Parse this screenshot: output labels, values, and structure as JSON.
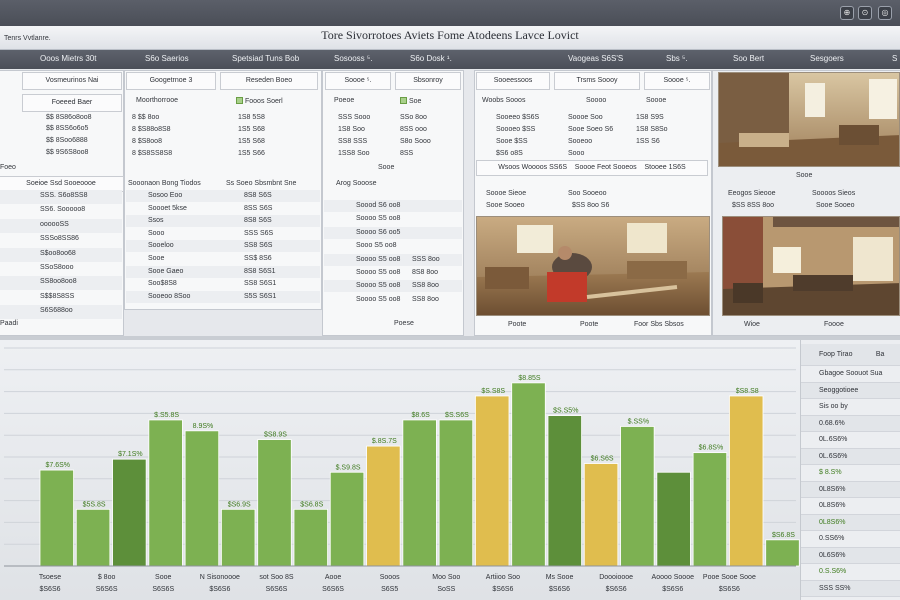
{
  "window": {
    "title": "Tore Sivorrotoes Aviets Fome Atodeens Lavce Lovict",
    "subtitle": "Tenrs Vvtlanre.",
    "buttons": [
      "⊕",
      "⊙",
      "◎"
    ]
  },
  "headers": [
    "Ooos Mietrs 30t",
    "S6o Saerios",
    "Spetsiad Tuns Bob",
    "Sosooss ⁵.",
    "S6o Dosk ¹.",
    "Vaogeas S6S'S",
    "Sbs ⁵.",
    "Soo Bert",
    "Sesgoers",
    "S"
  ],
  "table1": {
    "col_headers": [
      "Vosmeurinos Nai",
      "Foeeed Baer"
    ],
    "rows": [
      "$$ 8S86o8oo8",
      "$$ 8SS6o6o5",
      "$$ 8Soo6888",
      "$$ 9S6S8oo8"
    ],
    "left_items": [
      "Foeo",
      "Paadi"
    ],
    "section_header": "Soeioe Ssd Sooeoooe",
    "list": [
      "SSS. S6o8SS8",
      "SS6. Sooooo8",
      "oooooSS",
      "SSSo8SS86",
      "S$oo8oo68",
      "SSoS8ooo",
      "SS8oo8oo8",
      "S$$8S8SS",
      "S6S688oo"
    ]
  },
  "table2": {
    "col_headers": [
      "Googetrnoe 3",
      "Reseden Boeo"
    ],
    "sub_headers": [
      "Moorthorrooe",
      "Fooos Soerl"
    ],
    "rows": [
      [
        "8 $$ 8oo",
        "1S8 5S8"
      ],
      [
        "8 $S88o8S8",
        "1S5 S68"
      ],
      [
        "8 $S8oo8",
        "1S5 S68"
      ],
      [
        "8 $S8SS8S8",
        "1S5 S66"
      ]
    ],
    "section_header": "Sooonaon Bong Tiodos",
    "section_header2": "Ss Soeo Sbsmbnt Sne",
    "list_a": [
      "Sosoo Eoo",
      "Soooet 5kse",
      "Ssos",
      "Sooo",
      "Sooeloo",
      "Sooe",
      "Sooe Gaeo",
      "Soo$8S8",
      "Sooeoo 8Soo"
    ],
    "list_b": [
      "8S8 S6S",
      "8SS S6S",
      "8S8 S6S",
      "SSS S6S",
      "SS8 S6S",
      "SS$ 8S6",
      "8S8 S6S1",
      "SS8 S6S1",
      "S5S S6S1"
    ]
  },
  "table3": {
    "col_headers": [
      "Soooe ⁵.",
      "Sbsonroy"
    ],
    "sub_headers": [
      "Poeoe",
      "Soe"
    ],
    "rows": [
      [
        "SSS Sooo",
        "SSo 8oo"
      ],
      [
        "1S8 Soo",
        "8SS ooo"
      ],
      [
        "SS8 SSS",
        "S8o Sooo"
      ],
      [
        "1SS8 Soo",
        "8SS"
      ]
    ],
    "section_header": "Arog Sooose",
    "mid_item": "Sooe",
    "list": [
      [
        "Soood S6 oo8",
        ""
      ],
      [
        "Soooo S5 oo8",
        ""
      ],
      [
        "Soooo S6 oo5",
        ""
      ],
      [
        "Sooo S5 oo8",
        ""
      ],
      [
        "Soooo S5 oo8",
        "SSS 8oo"
      ],
      [
        "Soooo S5 oo8",
        "8S8 8oo"
      ],
      [
        "Soooo S5 oo8",
        "SS8 8oo"
      ],
      [
        "Soooo S5 oo8",
        "SS8 8oo"
      ]
    ],
    "footer": "Poese"
  },
  "table4": {
    "col_headers": [
      "Sooeessoos",
      "Trsms Soooy",
      "Soooe ⁵."
    ],
    "sub_headers": [
      "Woobs Sooos",
      "Soooo",
      "Soooe"
    ],
    "rows": [
      [
        "Sooeeo $S6S",
        "Soooe Soo",
        "1S8 S9S"
      ],
      [
        "Soooeo $SS",
        "Sooe Soeo S6",
        "1S8 S8So"
      ],
      [
        "Sooe $SS",
        "Sooeoo",
        "1SS S6"
      ],
      [
        "$S6 o8S",
        "Sooo",
        ""
      ]
    ],
    "bottom": [
      "Wsoos Woooos SS6S",
      "Soooe Feot Sooeos",
      "Stooee 1S6S"
    ]
  },
  "photo_captions": {
    "p1": [
      "Sooe",
      "Soooe Sieoe",
      "Soo Sooeoo"
    ],
    "p1b": [
      "Sooe Sooeo",
      "$SS 8oo S6"
    ],
    "p2": [
      "Wooo",
      "Poote",
      "Soooe"
    ],
    "p3": [
      "Pooe",
      "Foor Sbs Sbsos"
    ],
    "p4": [
      "Wioe",
      "Foooe"
    ],
    "p4b": [
      "Eeogos Sieooe",
      "Soooos Sieos",
      "$SS 8SS 8oo",
      "Sooe Sooeo"
    ]
  },
  "right_panel": {
    "header": [
      "Foop Tirao",
      "Ba"
    ],
    "items": [
      "Gbagoe Soouot Sua",
      "Seoggotioee",
      "Sis oo by",
      "0.68.6%",
      "0L.6S6%",
      "0L.6S6%",
      "$ 8.S%",
      "0L8S6%",
      "0L8S6%",
      "0L8S6%",
      "0.SS6%",
      "0L6S6%",
      "0.S.S6%",
      "SSS SS%"
    ]
  },
  "chart_data": {
    "type": "bar",
    "grid": true,
    "ylim": [
      0,
      100
    ],
    "bars": [
      {
        "value": 44,
        "color": "#7db152",
        "label": "$7.6S%"
      },
      {
        "value": 26,
        "color": "#7db152",
        "label": "$5S.8S"
      },
      {
        "value": 49,
        "color": "#5d8f3a",
        "label": "$7.1S%"
      },
      {
        "value": 67,
        "color": "#7db152",
        "label": "$.S5.8S"
      },
      {
        "value": 62,
        "color": "#7db152",
        "label": "8.9S%"
      },
      {
        "value": 26,
        "color": "#7db152",
        "label": "$S6.9S"
      },
      {
        "value": 58,
        "color": "#7db152",
        "label": "$S8.9S"
      },
      {
        "value": 26,
        "color": "#7db152",
        "label": "$S6.8S"
      },
      {
        "value": 43,
        "color": "#7db152",
        "label": "$.S9.8S"
      },
      {
        "value": 55,
        "color": "#e0bd4e",
        "label": "$.8S.7S"
      },
      {
        "value": 67,
        "color": "#7db152",
        "label": "$8.6S"
      },
      {
        "value": 67,
        "color": "#7db152",
        "label": "$S.S6S"
      },
      {
        "value": 78,
        "color": "#e0bd4e",
        "label": "$S.S8S"
      },
      {
        "value": 84,
        "color": "#7db152",
        "label": "$8.85S"
      },
      {
        "value": 69,
        "color": "#5d8f3a",
        "label": "$S.S5%"
      },
      {
        "value": 47,
        "color": "#e0bd4e",
        "label": "$6.S6S"
      },
      {
        "value": 64,
        "color": "#7db152",
        "label": "$.SS%"
      },
      {
        "value": 43,
        "color": "#5d8f3a",
        "label": ""
      },
      {
        "value": 52,
        "color": "#7db152",
        "label": "$6.8S%"
      },
      {
        "value": 78,
        "color": "#e0bd4e",
        "label": "$S8.S8"
      },
      {
        "value": 12,
        "color": "#7db152",
        "label": "$S6.8S"
      }
    ],
    "x_labels": [
      [
        "Tsoese",
        "$S6S6"
      ],
      [
        "$ 8oo",
        "S6S6S"
      ],
      [
        "Sooe",
        "S6S6S"
      ],
      [
        "N Sisonoooe",
        "$S6S6"
      ],
      [
        "sot Soo 8S",
        "S6S6S"
      ],
      [
        "Aooe",
        "S6S6S"
      ],
      [
        "Sooos",
        "S6S5"
      ],
      [
        "Moo Soo",
        "SoSS"
      ],
      [
        "Artiioo Soo",
        "$S6S6"
      ],
      [
        "Ms Sooe",
        "$S6S6"
      ],
      [
        "Doooioooe",
        "$S6S6"
      ],
      [
        "Aoooo Soooe",
        "$S6S6"
      ],
      [
        "Pooe Sooe Sooe",
        "$S6S6"
      ]
    ]
  }
}
